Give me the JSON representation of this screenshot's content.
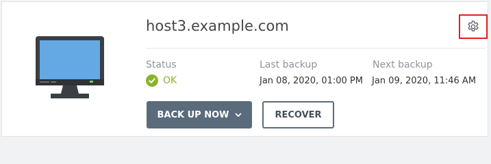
{
  "host": {
    "name": "host3.example.com"
  },
  "status": {
    "label": "Status",
    "value": "OK",
    "color": "#8bb42d"
  },
  "last_backup": {
    "label": "Last backup",
    "value": "Jan 08, 2020, 01:00 PM"
  },
  "next_backup": {
    "label": "Next backup",
    "value": "Jan 09, 2020, 11:46 AM"
  },
  "actions": {
    "back_up_now_label": "BACK UP NOW",
    "recover_label": "RECOVER"
  },
  "icons": {
    "device": "monitor-icon",
    "settings": "gear-icon",
    "status": "check-circle-icon",
    "dropdown": "chevron-down-icon"
  },
  "colors": {
    "primary_button": "#5a6b7b",
    "settings_highlight": "#e0201a",
    "screen": "#64a9e3"
  }
}
